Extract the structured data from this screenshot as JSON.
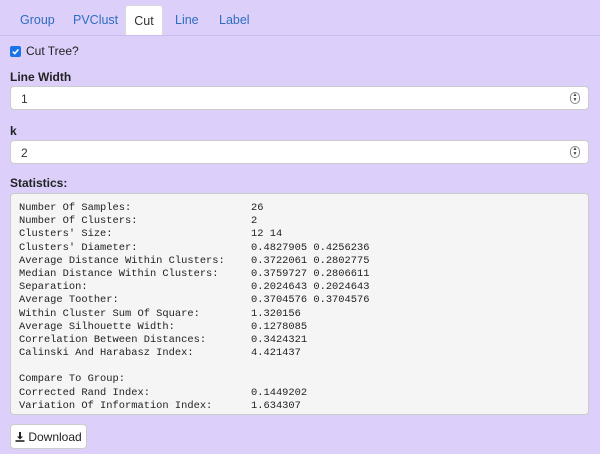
{
  "tabs": [
    {
      "label": "Group",
      "active": false
    },
    {
      "label": "PVClust",
      "active": false
    },
    {
      "label": "Cut",
      "active": true
    },
    {
      "label": "Line",
      "active": false
    },
    {
      "label": "Label",
      "active": false
    }
  ],
  "cut_tree": {
    "label": "Cut Tree?",
    "checked": true
  },
  "line_width": {
    "label": "Line Width",
    "value": "1"
  },
  "k": {
    "label": "k",
    "value": "2"
  },
  "statistics": {
    "label": "Statistics:",
    "rows": [
      {
        "label": "Number Of Samples:",
        "value": "26"
      },
      {
        "label": "Number Of Clusters:",
        "value": "2"
      },
      {
        "label": "Clusters' Size:",
        "value": "12 14"
      },
      {
        "label": "Clusters' Diameter:",
        "value": "0.4827905 0.4256236"
      },
      {
        "label": "Average Distance Within Clusters:",
        "value": "0.3722061 0.2802775"
      },
      {
        "label": "Median Distance Within Clusters:",
        "value": "0.3759727 0.2806611"
      },
      {
        "label": "Separation:",
        "value": "0.2024643 0.2024643"
      },
      {
        "label": "Average Toother:",
        "value": "0.3704576 0.3704576"
      },
      {
        "label": "Within Cluster Sum Of Square:",
        "value": "1.320156"
      },
      {
        "label": "Average Silhouette Width:",
        "value": "0.1278085"
      },
      {
        "label": "Correlation Between Distances:",
        "value": "0.3424321"
      },
      {
        "label": "Calinski And Harabasz Index:",
        "value": "4.421437"
      },
      {
        "label": "",
        "value": ""
      },
      {
        "label": "Compare To Group:",
        "value": ""
      },
      {
        "label": "Corrected Rand Index:",
        "value": "0.1449202"
      },
      {
        "label": "Variation Of Information Index:",
        "value": "1.634307"
      }
    ]
  },
  "download": {
    "label": "Download",
    "icon": "download-icon"
  },
  "colors": {
    "background": "#dcd0fb",
    "link": "#2f6dbf",
    "checkbox": "#1a73e8"
  }
}
